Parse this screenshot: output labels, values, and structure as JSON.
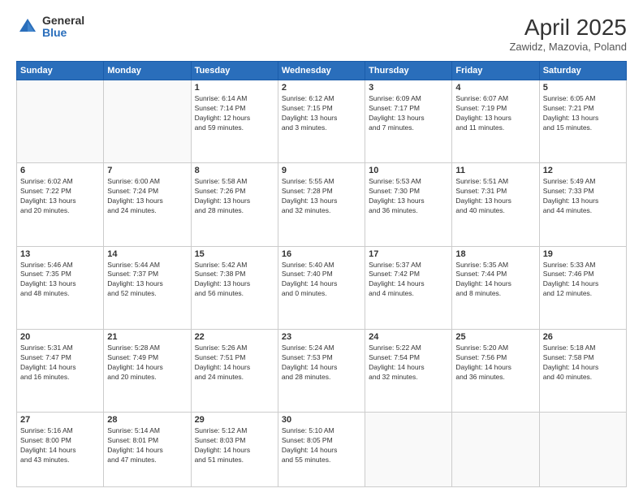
{
  "header": {
    "logo_general": "General",
    "logo_blue": "Blue",
    "title": "April 2025",
    "subtitle": "Zawidz, Mazovia, Poland"
  },
  "weekdays": [
    "Sunday",
    "Monday",
    "Tuesday",
    "Wednesday",
    "Thursday",
    "Friday",
    "Saturday"
  ],
  "weeks": [
    [
      {
        "day": "",
        "lines": []
      },
      {
        "day": "",
        "lines": []
      },
      {
        "day": "1",
        "lines": [
          "Sunrise: 6:14 AM",
          "Sunset: 7:14 PM",
          "Daylight: 12 hours",
          "and 59 minutes."
        ]
      },
      {
        "day": "2",
        "lines": [
          "Sunrise: 6:12 AM",
          "Sunset: 7:15 PM",
          "Daylight: 13 hours",
          "and 3 minutes."
        ]
      },
      {
        "day": "3",
        "lines": [
          "Sunrise: 6:09 AM",
          "Sunset: 7:17 PM",
          "Daylight: 13 hours",
          "and 7 minutes."
        ]
      },
      {
        "day": "4",
        "lines": [
          "Sunrise: 6:07 AM",
          "Sunset: 7:19 PM",
          "Daylight: 13 hours",
          "and 11 minutes."
        ]
      },
      {
        "day": "5",
        "lines": [
          "Sunrise: 6:05 AM",
          "Sunset: 7:21 PM",
          "Daylight: 13 hours",
          "and 15 minutes."
        ]
      }
    ],
    [
      {
        "day": "6",
        "lines": [
          "Sunrise: 6:02 AM",
          "Sunset: 7:22 PM",
          "Daylight: 13 hours",
          "and 20 minutes."
        ]
      },
      {
        "day": "7",
        "lines": [
          "Sunrise: 6:00 AM",
          "Sunset: 7:24 PM",
          "Daylight: 13 hours",
          "and 24 minutes."
        ]
      },
      {
        "day": "8",
        "lines": [
          "Sunrise: 5:58 AM",
          "Sunset: 7:26 PM",
          "Daylight: 13 hours",
          "and 28 minutes."
        ]
      },
      {
        "day": "9",
        "lines": [
          "Sunrise: 5:55 AM",
          "Sunset: 7:28 PM",
          "Daylight: 13 hours",
          "and 32 minutes."
        ]
      },
      {
        "day": "10",
        "lines": [
          "Sunrise: 5:53 AM",
          "Sunset: 7:30 PM",
          "Daylight: 13 hours",
          "and 36 minutes."
        ]
      },
      {
        "day": "11",
        "lines": [
          "Sunrise: 5:51 AM",
          "Sunset: 7:31 PM",
          "Daylight: 13 hours",
          "and 40 minutes."
        ]
      },
      {
        "day": "12",
        "lines": [
          "Sunrise: 5:49 AM",
          "Sunset: 7:33 PM",
          "Daylight: 13 hours",
          "and 44 minutes."
        ]
      }
    ],
    [
      {
        "day": "13",
        "lines": [
          "Sunrise: 5:46 AM",
          "Sunset: 7:35 PM",
          "Daylight: 13 hours",
          "and 48 minutes."
        ]
      },
      {
        "day": "14",
        "lines": [
          "Sunrise: 5:44 AM",
          "Sunset: 7:37 PM",
          "Daylight: 13 hours",
          "and 52 minutes."
        ]
      },
      {
        "day": "15",
        "lines": [
          "Sunrise: 5:42 AM",
          "Sunset: 7:38 PM",
          "Daylight: 13 hours",
          "and 56 minutes."
        ]
      },
      {
        "day": "16",
        "lines": [
          "Sunrise: 5:40 AM",
          "Sunset: 7:40 PM",
          "Daylight: 14 hours",
          "and 0 minutes."
        ]
      },
      {
        "day": "17",
        "lines": [
          "Sunrise: 5:37 AM",
          "Sunset: 7:42 PM",
          "Daylight: 14 hours",
          "and 4 minutes."
        ]
      },
      {
        "day": "18",
        "lines": [
          "Sunrise: 5:35 AM",
          "Sunset: 7:44 PM",
          "Daylight: 14 hours",
          "and 8 minutes."
        ]
      },
      {
        "day": "19",
        "lines": [
          "Sunrise: 5:33 AM",
          "Sunset: 7:46 PM",
          "Daylight: 14 hours",
          "and 12 minutes."
        ]
      }
    ],
    [
      {
        "day": "20",
        "lines": [
          "Sunrise: 5:31 AM",
          "Sunset: 7:47 PM",
          "Daylight: 14 hours",
          "and 16 minutes."
        ]
      },
      {
        "day": "21",
        "lines": [
          "Sunrise: 5:28 AM",
          "Sunset: 7:49 PM",
          "Daylight: 14 hours",
          "and 20 minutes."
        ]
      },
      {
        "day": "22",
        "lines": [
          "Sunrise: 5:26 AM",
          "Sunset: 7:51 PM",
          "Daylight: 14 hours",
          "and 24 minutes."
        ]
      },
      {
        "day": "23",
        "lines": [
          "Sunrise: 5:24 AM",
          "Sunset: 7:53 PM",
          "Daylight: 14 hours",
          "and 28 minutes."
        ]
      },
      {
        "day": "24",
        "lines": [
          "Sunrise: 5:22 AM",
          "Sunset: 7:54 PM",
          "Daylight: 14 hours",
          "and 32 minutes."
        ]
      },
      {
        "day": "25",
        "lines": [
          "Sunrise: 5:20 AM",
          "Sunset: 7:56 PM",
          "Daylight: 14 hours",
          "and 36 minutes."
        ]
      },
      {
        "day": "26",
        "lines": [
          "Sunrise: 5:18 AM",
          "Sunset: 7:58 PM",
          "Daylight: 14 hours",
          "and 40 minutes."
        ]
      }
    ],
    [
      {
        "day": "27",
        "lines": [
          "Sunrise: 5:16 AM",
          "Sunset: 8:00 PM",
          "Daylight: 14 hours",
          "and 43 minutes."
        ]
      },
      {
        "day": "28",
        "lines": [
          "Sunrise: 5:14 AM",
          "Sunset: 8:01 PM",
          "Daylight: 14 hours",
          "and 47 minutes."
        ]
      },
      {
        "day": "29",
        "lines": [
          "Sunrise: 5:12 AM",
          "Sunset: 8:03 PM",
          "Daylight: 14 hours",
          "and 51 minutes."
        ]
      },
      {
        "day": "30",
        "lines": [
          "Sunrise: 5:10 AM",
          "Sunset: 8:05 PM",
          "Daylight: 14 hours",
          "and 55 minutes."
        ]
      },
      {
        "day": "",
        "lines": []
      },
      {
        "day": "",
        "lines": []
      },
      {
        "day": "",
        "lines": []
      }
    ]
  ]
}
